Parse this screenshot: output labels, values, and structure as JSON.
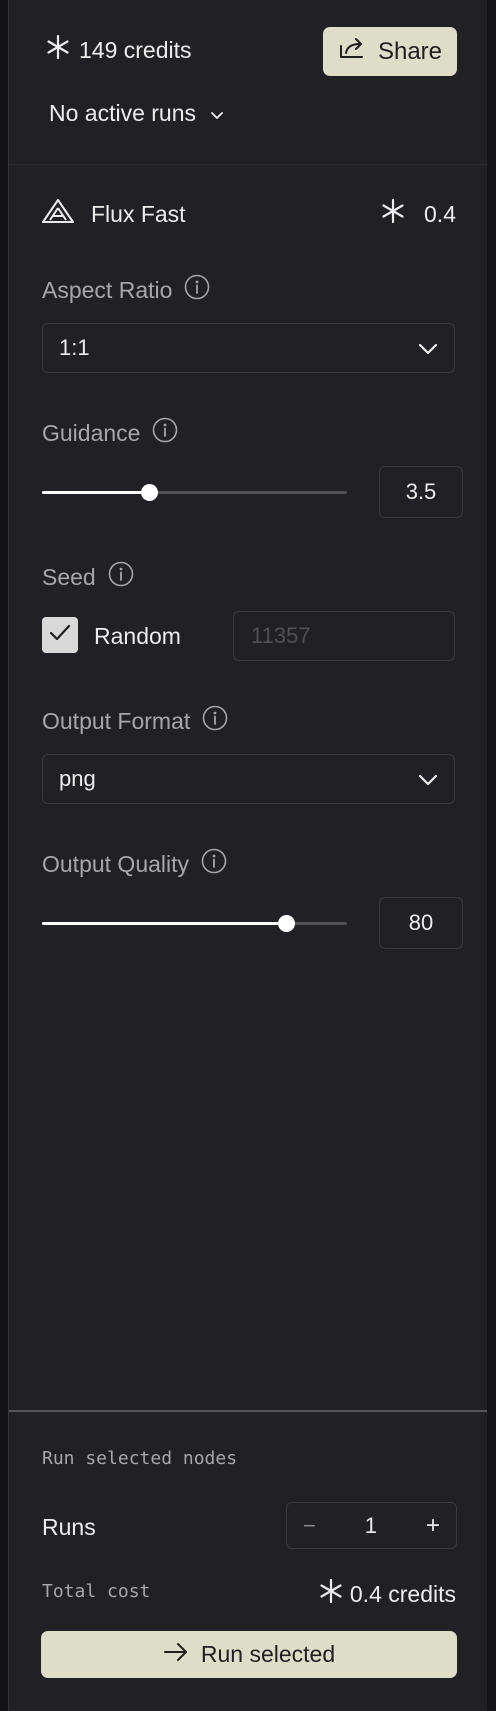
{
  "header": {
    "credits_text": "149 credits",
    "share_label": "Share",
    "runs_status": "No active runs"
  },
  "model": {
    "name": "Flux Fast",
    "cost": "0.4"
  },
  "params": {
    "aspect_ratio": {
      "label": "Aspect Ratio",
      "value": "1:1"
    },
    "guidance": {
      "label": "Guidance",
      "value": "3.5",
      "slider_fraction": 0.35
    },
    "seed": {
      "label": "Seed",
      "random_label": "Random",
      "random_checked": true,
      "placeholder": "11357"
    },
    "output_format": {
      "label": "Output Format",
      "value": "png"
    },
    "output_quality": {
      "label": "Output Quality",
      "value": "80",
      "slider_fraction": 0.8
    }
  },
  "footer": {
    "section_title": "Run selected nodes",
    "runs_label": "Runs",
    "runs_count": "1",
    "decrement": "−",
    "increment": "+",
    "total_label": "Total cost",
    "total_value": "0.4 credits",
    "run_button": "Run selected"
  },
  "colors": {
    "panel_bg": "#212125",
    "accent_button": "#deddc8",
    "muted_text": "#a6a6ab"
  },
  "icons": [
    "asterisk-icon",
    "share-icon",
    "chevron-down-icon",
    "flux-logo-icon",
    "info-icon",
    "check-icon",
    "arrow-right-icon"
  ]
}
